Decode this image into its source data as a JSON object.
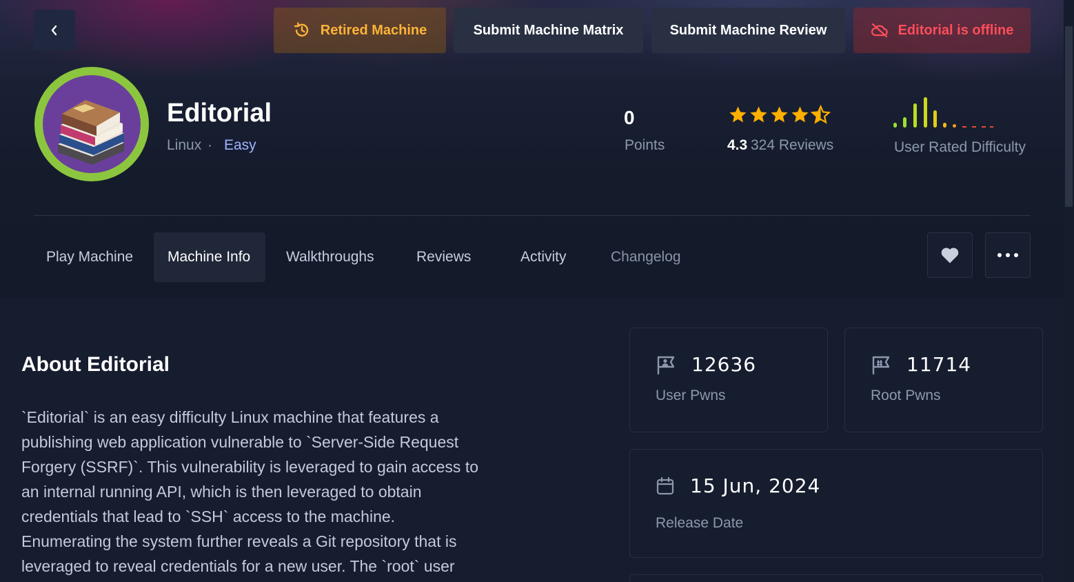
{
  "header": {
    "retired_label": "Retired Machine",
    "matrix_label": "Submit Machine Matrix",
    "review_label": "Submit Machine Review",
    "editorial_label": "Editorial is offline"
  },
  "machine": {
    "name": "Editorial",
    "os": "Linux",
    "separator": "·",
    "difficulty": "Easy",
    "points": "0",
    "points_label": "Points",
    "rating": "4.3",
    "reviews": "324 Reviews",
    "rating_stars": 4.5,
    "difficulty_label": "User Rated Difficulty"
  },
  "tabs": [
    {
      "label": "Play Machine"
    },
    {
      "label": "Machine Info"
    },
    {
      "label": "Walkthroughs"
    },
    {
      "label": "Reviews"
    },
    {
      "label": "Activity"
    },
    {
      "label": "Changelog"
    }
  ],
  "about": {
    "title": "About Editorial",
    "lines": [
      "`Editorial` is an easy difficulty Linux machine that features a",
      "publishing web application vulnerable to `Server-Side Request",
      "Forgery (SSRF)`. This vulnerability is leveraged to gain access to",
      "an internal running API, which is then leveraged to obtain",
      "credentials that lead to `SSH` access to the machine.",
      "Enumerating the system further reveals a Git repository that is",
      "leveraged to reveal credentials for a new user. The `root` user"
    ]
  },
  "stats": {
    "user_pwns": "12636",
    "user_pwns_label": "User Pwns",
    "root_pwns": "11714",
    "root_pwns_label": "Root Pwns",
    "release_date": "15 Jun, 2024",
    "release_date_label": "Release Date"
  },
  "colors": {
    "accent_green": "#8cc63f",
    "retired_orange": "#ffb338",
    "offline_red": "#ff4d5a",
    "star_yellow": "#ffaf00",
    "difficulty_link": "#9fb3ff"
  }
}
